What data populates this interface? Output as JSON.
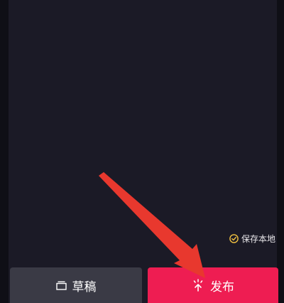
{
  "footer": {
    "save_local_label": "保存本地",
    "draft_label": "草稿",
    "publish_label": "发布"
  },
  "colors": {
    "background": "#1b1a26",
    "draft_button": "#3a3a45",
    "publish_button": "#ee1d52",
    "annotation_arrow": "#e8382e",
    "check_icon": "#f0c040"
  },
  "icons": {
    "save_local": "check-circle-icon",
    "draft": "draft-box-icon",
    "publish": "upload-sparkle-icon"
  }
}
